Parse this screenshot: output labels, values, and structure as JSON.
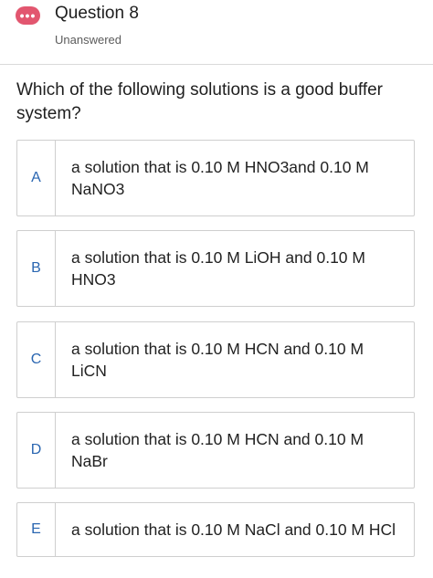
{
  "header": {
    "menu_glyph": "•••",
    "title": "Question 8",
    "status": "Unanswered"
  },
  "question": {
    "text": "Which of the following solutions is a good buffer system?"
  },
  "options": [
    {
      "letter": "A",
      "text": "a solution that is 0.10 M HNO3and 0.10 M NaNO3"
    },
    {
      "letter": "B",
      "text": "a solution that is 0.10 M LiOH and 0.10 M HNO3"
    },
    {
      "letter": "C",
      "text": "a solution that is 0.10 M HCN and 0.10 M LiCN"
    },
    {
      "letter": "D",
      "text": "a solution that is 0.10 M HCN and 0.10 M NaBr"
    },
    {
      "letter": "E",
      "text": "a solution that is 0.10 M NaCl and 0.10 M HCl"
    }
  ],
  "colors": {
    "accent_badge": "#e2566f",
    "option_letter": "#2a66b1",
    "border": "#cfcfcf"
  }
}
